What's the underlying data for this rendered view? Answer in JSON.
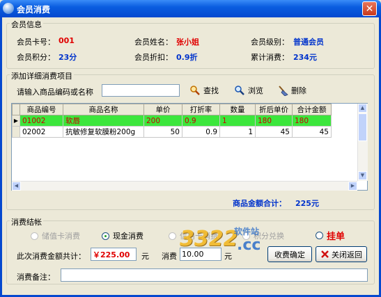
{
  "window": {
    "title": "会员消费",
    "close_glyph": "✕"
  },
  "member_info": {
    "legend": "会员信息",
    "card_no_label": "会员卡号：",
    "card_no": "001",
    "name_label": "会员姓名：",
    "name": "张小姐",
    "level_label": "会员级别：",
    "level": "普通会员",
    "points_label": "会员积分：",
    "points": "23分",
    "discount_label": "会员折扣：",
    "discount": "0.9折",
    "total_label": "累计消费：",
    "total": "234元"
  },
  "add_items": {
    "legend": "添加详细消费项目",
    "search_label": "请输入商品编码或名称",
    "search_value": "",
    "find_label": "查找",
    "browse_label": "浏览",
    "delete_label": "删除"
  },
  "grid": {
    "columns": [
      "商品编号",
      "商品名称",
      "单价",
      "打折率",
      "数量",
      "折后单价",
      "合计金额"
    ],
    "rows": [
      {
        "marker": "▶",
        "cells": [
          "01002",
          "软唇",
          "200",
          "0.9",
          "1",
          "180",
          "180"
        ],
        "selected": true
      },
      {
        "marker": "",
        "cells": [
          "02002",
          "抗敏修复软膜粉200g",
          "50",
          "0.9",
          "1",
          "45",
          "45"
        ],
        "selected": false
      }
    ]
  },
  "total_line": {
    "label": "商品金额合计：",
    "value": "225元"
  },
  "checkout": {
    "legend": "消费结帐",
    "options": [
      "储值卡消费",
      "现金消费",
      "信用卡消费",
      "积分兑换"
    ],
    "selected_option": 1,
    "credit_label": "挂单",
    "amount_label": "此次消费金额共计：",
    "amount_value": "￥225.00",
    "amount_unit": "元",
    "received_label": "消费",
    "received_value": "10.00",
    "received_unit": "元",
    "confirm_label": "收费确定",
    "close_label": "关闭返回",
    "remark_label": "消费备注：",
    "remark_value": ""
  },
  "watermark": {
    "number": "3322",
    "domain": ".cc",
    "tag": "软件站"
  }
}
